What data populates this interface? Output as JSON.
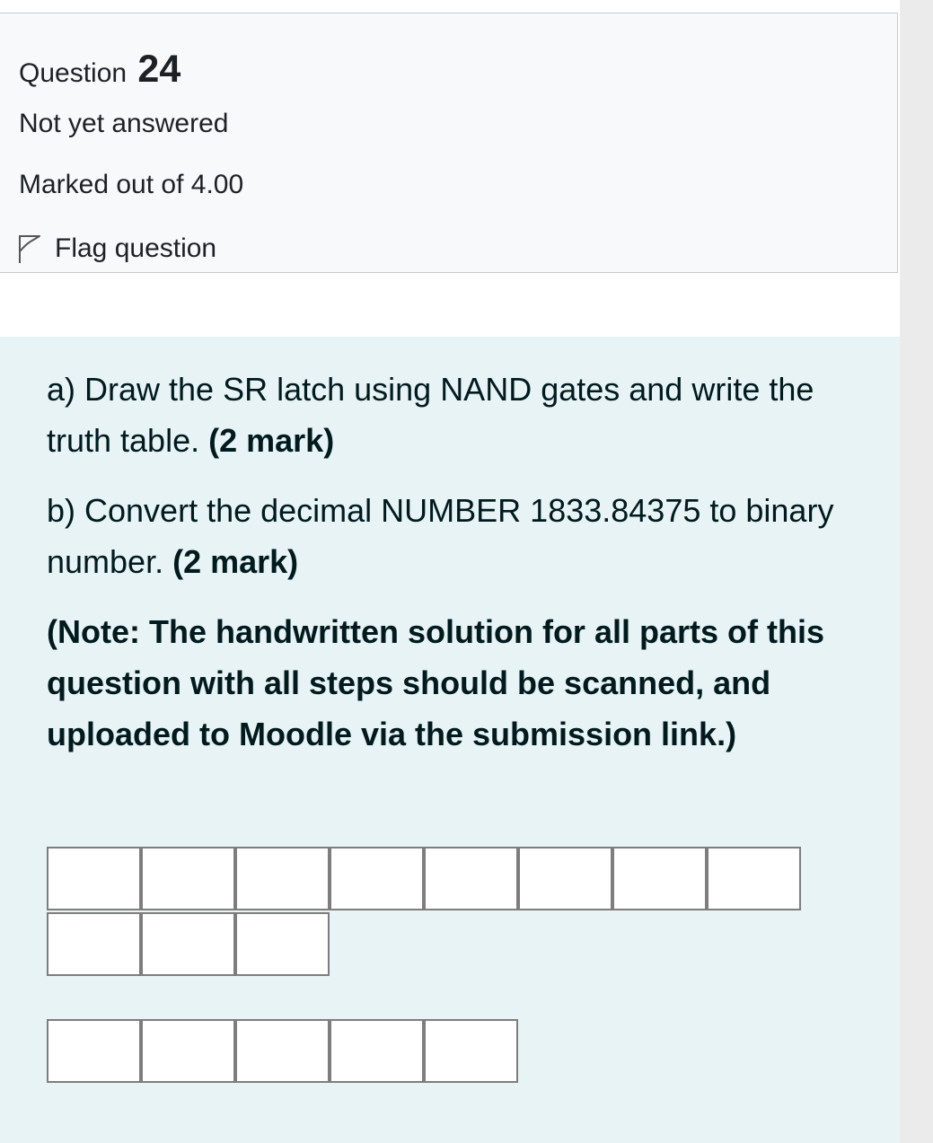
{
  "question": {
    "label": "Question",
    "number": "24",
    "state": "Not yet answered",
    "grade": "Marked out of 4.00",
    "flag_label": "Flag question",
    "flag_icon": "flag-outline-icon"
  },
  "qtext": {
    "part_a_text": "a) Draw the SR latch using NAND gates and write the truth table.",
    "part_a_marks": "(2 mark)",
    "part_b_text": "b) Convert the decimal NUMBER 1833.84375 to binary number.",
    "part_b_marks": "(2 mark)",
    "note": "(Note: The handwritten solution for all parts of this question with all steps should be scanned, and uploaded to Moodle via the submission link.)"
  },
  "answer_boxes": {
    "integer_part_count": 11,
    "fraction_part_count": 5,
    "integer_part_values": [
      "",
      "",
      "",
      "",
      "",
      "",
      "",
      "",
      "",
      "",
      ""
    ],
    "fraction_part_values": [
      "",
      "",
      "",
      "",
      ""
    ]
  },
  "colors": {
    "content_background": "#e7f3f5",
    "info_background": "#f8f9fa",
    "text": "#001a1e"
  }
}
